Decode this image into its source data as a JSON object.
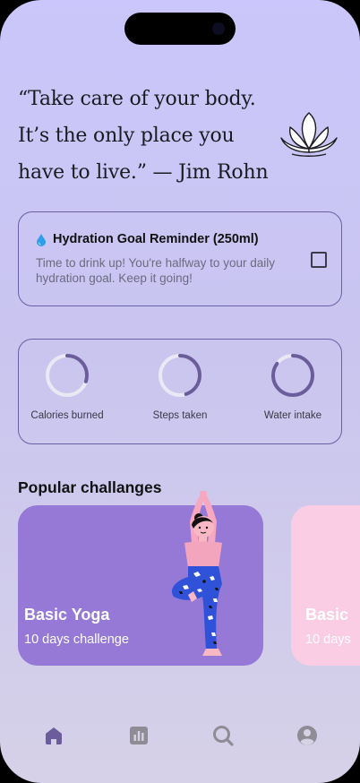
{
  "quote": {
    "line1": "“Take care of your body.",
    "line2": "It’s the only place you",
    "line3": "have to live.” — Jim Rohn"
  },
  "hydration": {
    "icon": "water-drop-icon",
    "title": "Hydration Goal Reminder (250ml)",
    "description": "Time to drink up! You're halfway to your daily hydration goal. Keep it going!",
    "checked": false
  },
  "stats": [
    {
      "label": "Calories burned",
      "progress": 0.3
    },
    {
      "label": "Steps taken",
      "progress": 0.45
    },
    {
      "label": "Water intake",
      "progress": 0.85
    }
  ],
  "section_title": "Popular challanges",
  "challenges": [
    {
      "name": "Basic Yoga",
      "subtitle": "10 days challenge"
    },
    {
      "name": "Basic",
      "subtitle": "10 days"
    }
  ],
  "tabs": [
    {
      "icon": "home-icon",
      "active": true
    },
    {
      "icon": "chart-icon",
      "active": false
    },
    {
      "icon": "search-icon",
      "active": false
    },
    {
      "icon": "profile-icon",
      "active": false
    }
  ],
  "colors": {
    "accent": "#6b5fa3",
    "ring_track": "#ebe8f5",
    "ring_fill": "#6b5c9c",
    "card_yoga": "#9678d6",
    "card_pink": "#fbcde4",
    "tab_inactive": "#8f8c96"
  }
}
